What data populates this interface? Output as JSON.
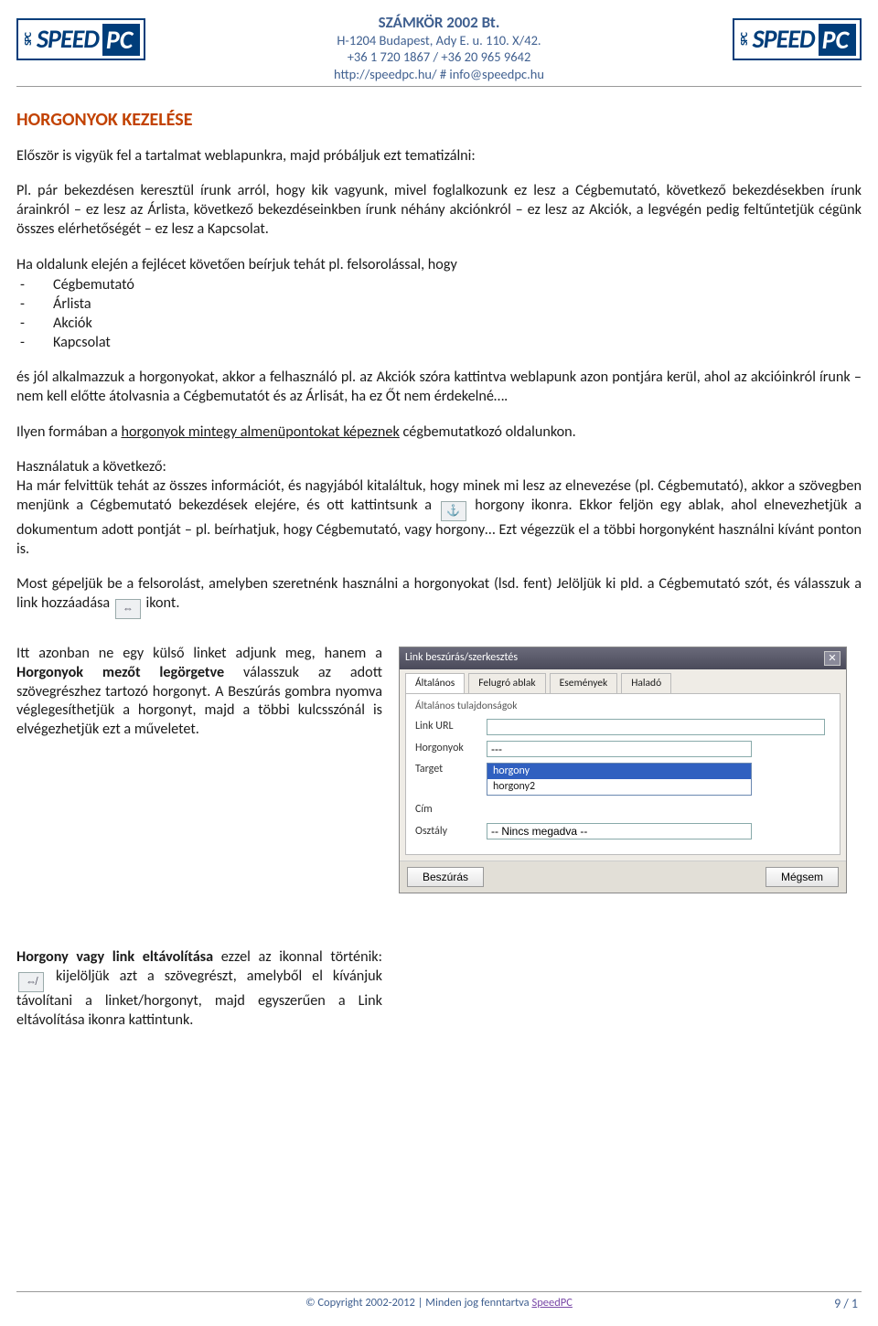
{
  "header": {
    "logo_spc": "SPC",
    "logo_speed": "SPEED",
    "logo_pc": "PC",
    "company": "SZÁMKÖR 2002 Bt.",
    "address": "H-1204 Budapest, Ady E. u. 110. X/42.",
    "phone": "+36 1 720 1867 / +36 20 965 9642",
    "web": "http://speedpc.hu/ # info@speedpc.hu"
  },
  "title": "HORGONYOK KEZELÉSE",
  "para1": "Először is vigyük fel a tartalmat weblapunkra, majd próbáljuk ezt tematizálni:",
  "para2": "Pl. pár bekezdésen keresztül írunk arról, hogy kik vagyunk, mivel foglalkozunk ez lesz a Cégbemutató, következő bekezdésekben írunk árainkról – ez lesz az Árlista, következő bekezdéseinkben írunk néhány akciónkról – ez lesz az Akciók, a legvégén pedig feltűntetjük cégünk összes elérhetőségét – ez lesz a Kapcsolat.",
  "para3": "Ha oldalunk elején a fejlécet követően beírjuk tehát pl. felsorolással, hogy",
  "list": [
    "Cégbemutató",
    "Árlista",
    "Akciók",
    "Kapcsolat"
  ],
  "para4": "és jól alkalmazzuk a horgonyokat, akkor a felhasználó pl. az Akciók szóra kattintva weblapunk azon pontjára kerül, ahol az akcióinkról írunk – nem kell előtte átolvasnia a Cégbemutatót és az Árlisát, ha ez Őt nem érdekelné….",
  "para5a": "Ilyen formában a ",
  "para5u": "horgonyok mintegy almenüpontokat képeznek",
  "para5b": " cégbemutatkozó oldalunkon.",
  "para6a": "Használatuk a következő:",
  "para6b": "Ha már felvittük tehát az összes információt, és nagyjából kitaláltuk, hogy minek mi lesz az elnevezése (pl. Cégbemutató), akkor a szövegben menjünk a Cégbemutató bekezdések elejére, és ott kattintsunk a ",
  "icon_anchor": "⚓",
  "para6c": " horgony ikonra. Ekkor feljön egy ablak, ahol elnevezhetjük a dokumentum adott pontját – pl. beírhatjuk, hogy Cégbemutató, vagy horgony… Ezt végezzük el a többi horgonyként használni kívánt ponton is.",
  "para7a": "Most gépeljük be a felsorolást, amelyben szeretnénk használni a horgonyokat (lsd. fent) Jelöljük ki pld. a Cégbemutató szót, és válasszuk a link hozzáadása ",
  "icon_link": "⇔",
  "para7b": "ikont.",
  "left1a": "Itt azonban ne egy külső linket adjunk meg, hanem a ",
  "left1b": "Horgonyok mezőt legörgetve",
  "left1c": " válasszuk az adott szövegrészhez tartozó horgonyt. A Beszúrás gombra nyomva véglegesíthetjük a horgonyt, majd a többi kulcsszónál is elvégezhetjük ezt a műveletet.",
  "dialog": {
    "title": "Link beszúrás/szerkesztés",
    "tabs": [
      "Általános",
      "Felugró ablak",
      "Események",
      "Haladó"
    ],
    "legend": "Általános tulajdonságok",
    "labels": {
      "url": "Link URL",
      "anchor": "Horgonyok",
      "target": "Target",
      "cim": "Cím",
      "osztaly": "Osztály"
    },
    "anchor_sel": "---",
    "options": [
      "horgony",
      "horgony2"
    ],
    "osztaly_val": "-- Nincs megadva --",
    "btn_insert": "Beszúrás",
    "btn_cancel": "Mégsem"
  },
  "rem1": "Horgony vagy link eltávolítása",
  "rem2": " ezzel az ikonnal történik: ",
  "icon_unlink": "⇎",
  "rem3": "kijelöljük azt a szövegrészt, amelyből el kívánjuk távolítani a linket/horgonyt, majd egyszerűen a Link eltávolítása ikonra kattintunk.",
  "footer": {
    "copyright": "© Copyright 2002-2012 | Minden jog fenntartva ",
    "brand": "SpeedPC",
    "page": "9 / 1"
  }
}
